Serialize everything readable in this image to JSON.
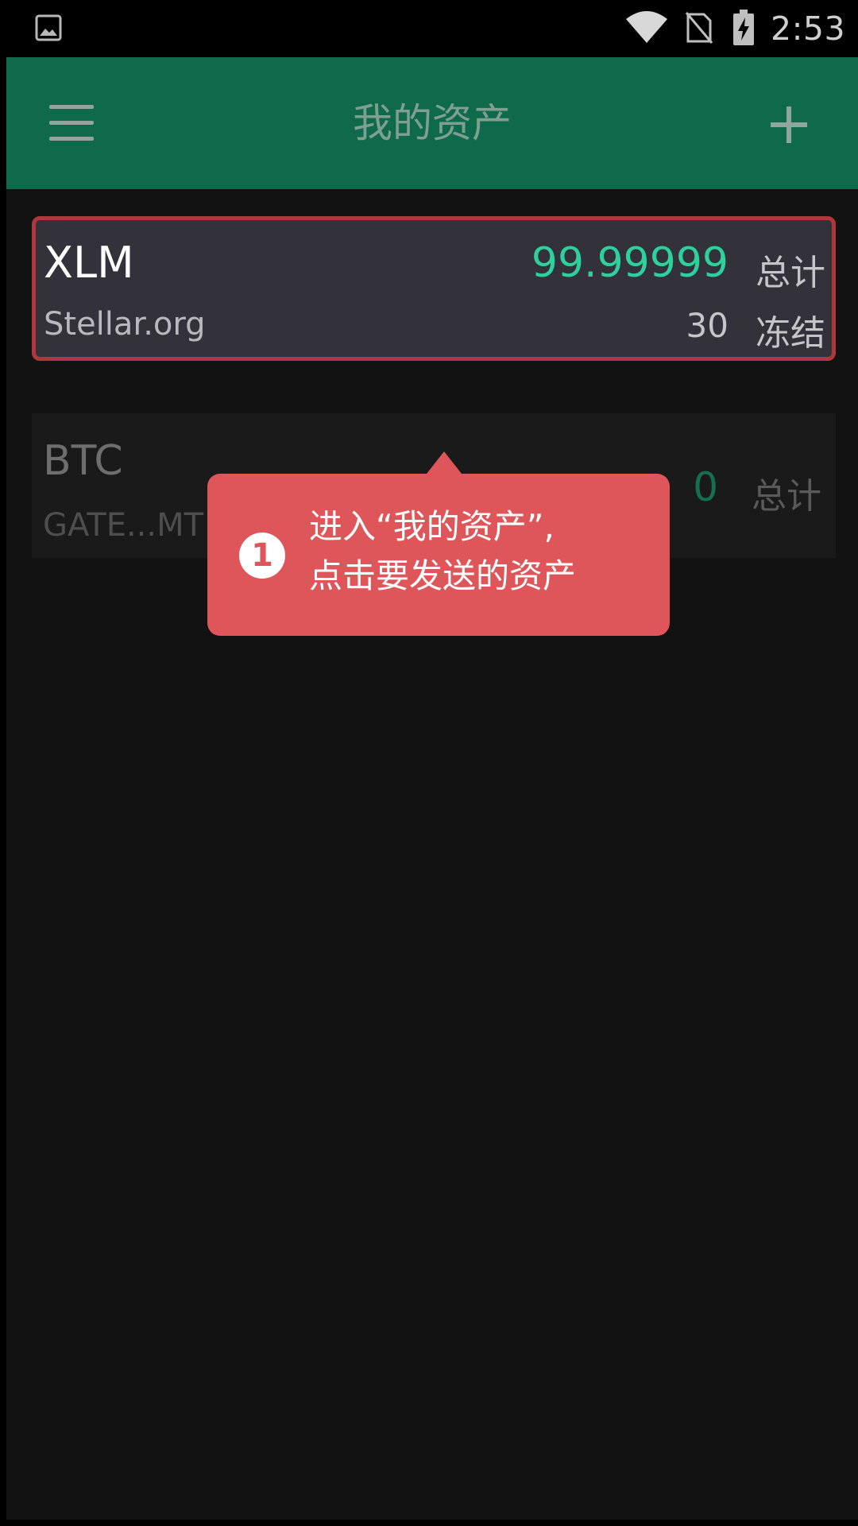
{
  "status_bar": {
    "time": "2:53",
    "icons": [
      "image-icon",
      "wifi-icon",
      "no-sim-icon",
      "battery-charging-icon"
    ]
  },
  "toolbar": {
    "title": "我的资产",
    "menu_icon": "menu-icon",
    "add_icon": "plus-icon"
  },
  "assets": [
    {
      "code": "XLM",
      "issuer": "Stellar.org",
      "total": "99.99999",
      "total_label": "总计",
      "frozen": "30",
      "frozen_label": "冻结"
    },
    {
      "code": "BTC",
      "issuer": "GATE...MT",
      "total": "0",
      "total_label": "总计"
    }
  ],
  "tooltip": {
    "step": "1",
    "line1": "进入“我的资产”,",
    "line2": "点击要发送的资产"
  },
  "colors": {
    "toolbar": "#0f6a4b",
    "amount_green": "#2ed09b",
    "highlight_border": "#b0383c",
    "tooltip_bg": "#de5659"
  }
}
